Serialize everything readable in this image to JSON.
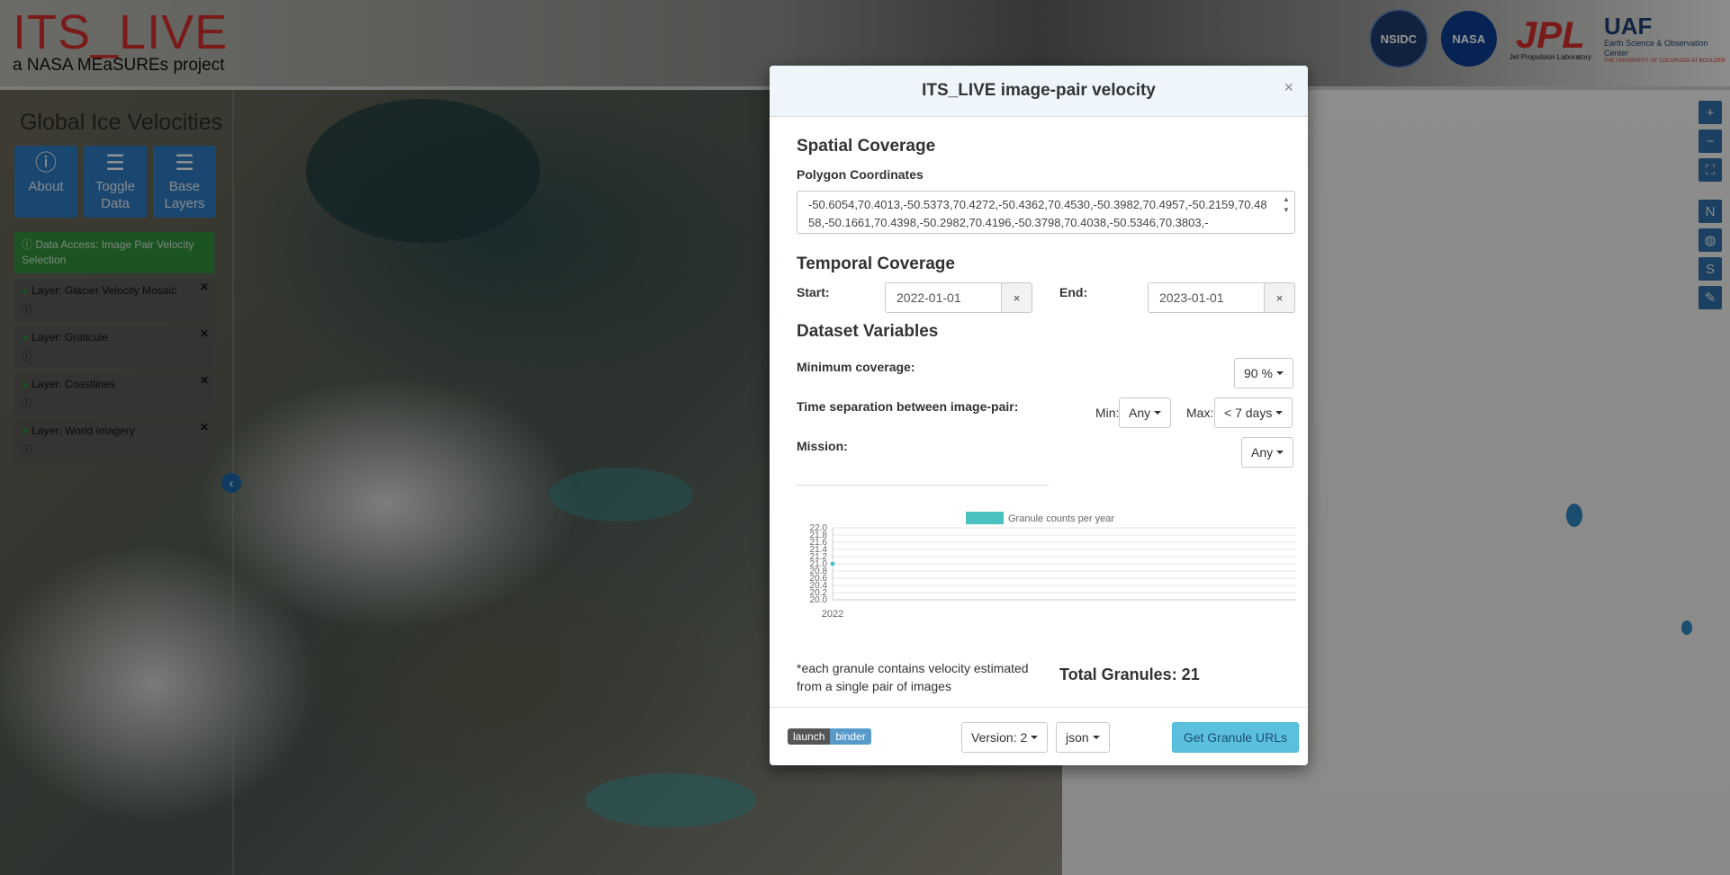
{
  "header": {
    "brand_title": "ITS_LIVE",
    "brand_subtitle": "a NASA MEaSUREs project",
    "logos": {
      "nsidc": "NSIDC",
      "nasa": "NASA",
      "jpl": "JPL",
      "jpl_sub": "Jet Propulsion Laboratory",
      "uaf": "UAF",
      "uaf_sub": "Earth Science & Observation Center",
      "uaf_sub2": "THE UNIVERSITY OF COLORADO AT BOULDER"
    }
  },
  "sidebar": {
    "title": "Global Ice Velocities",
    "buttons": [
      {
        "label": "About",
        "icon": "info-icon"
      },
      {
        "label": "Toggle Data",
        "icon": "table-icon"
      },
      {
        "label": "Base Layers",
        "icon": "table-icon"
      }
    ],
    "data_access": "Data Access: Image Pair Velocity Selection",
    "layers": [
      {
        "label": "Layer: Glacier Velocity Mosaic"
      },
      {
        "label": "Layer: Graticule"
      },
      {
        "label": "Layer: Coastlines"
      },
      {
        "label": "Layer: World Imagery"
      }
    ]
  },
  "map_controls": [
    "zoom-in-icon",
    "zoom-out-icon",
    "fullscreen-icon",
    "north-icon",
    "globe-icon",
    "s-icon",
    "pencil-icon"
  ],
  "map_controls_text": {
    "north": "N",
    "s": "S"
  },
  "modal": {
    "title": "ITS_LIVE image-pair velocity",
    "close": "×",
    "spatial": {
      "heading": "Spatial Coverage",
      "polygon_label": "Polygon Coordinates",
      "polygon_value": "-50.6054,70.4013,-50.5373,70.4272,-50.4362,70.4530,-50.3982,70.4957,-50.2159,70.4858,-50.1661,70.4398,-50.2982,70.4196,-50.3798,70.4038,-50.5346,70.3803,-"
    },
    "temporal": {
      "heading": "Temporal Coverage",
      "start_label": "Start:",
      "start_value": "2022-01-01",
      "end_label": "End:",
      "end_value": "2023-01-01",
      "clear": "×"
    },
    "variables": {
      "heading": "Dataset Variables",
      "min_coverage_label": "Minimum coverage:",
      "min_coverage_value": "90 %",
      "time_sep_label": "Time separation between image-pair:",
      "min_label": "Min:",
      "min_value": "Any",
      "max_label": "Max:",
      "max_value": "< 7 days",
      "mission_label": "Mission:",
      "mission_value": "Any"
    },
    "note": "*each granule contains velocity estimated from a single pair of images",
    "total": "Total Granules: 21",
    "footer": {
      "binder_left": "launch",
      "binder_right": "binder",
      "version": "Version: 2",
      "format": "json",
      "get_urls": "Get Granule URLs"
    }
  },
  "colors": {
    "accent": "#2e7bbf",
    "success": "#2f8f3c",
    "info_button": "#5bc0de",
    "brand_red": "#d0302b",
    "series": "#4bc0c0"
  },
  "chart_data": {
    "type": "bar",
    "categories": [
      "2022"
    ],
    "series": [
      {
        "name": "Granule counts per year",
        "values": [
          21
        ]
      }
    ],
    "ylim": [
      20.0,
      22.0
    ],
    "yticks": [
      "22.0",
      "21.8",
      "21.6",
      "21.4",
      "21.2",
      "21.0",
      "20.8",
      "20.6",
      "20.4",
      "20.2",
      "20.0"
    ],
    "legend": "top",
    "grid": true
  }
}
